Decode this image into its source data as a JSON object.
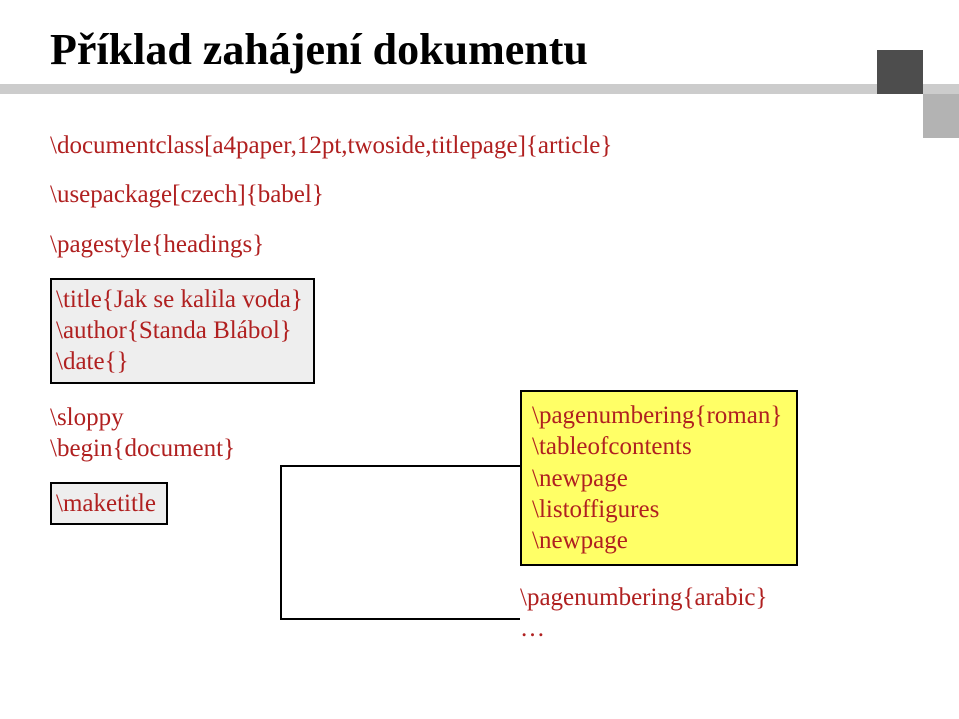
{
  "title": "Příklad zahájení dokumentu",
  "code": {
    "l1": "\\documentclass[a4paper,12pt,twoside,titlepage]{article}",
    "l2": "\\usepackage[czech]{babel}",
    "l3": "\\pagestyle{headings}",
    "l4": "\\title{Jak se kalila voda}",
    "l5": "\\author{Standa Blábol}",
    "l6": "\\date{}",
    "l7": "\\sloppy",
    "l8": "\\begin{document}",
    "l9": "\\maketitle"
  },
  "yellow": {
    "y1": "\\pagenumbering{roman}",
    "y2": "\\tableofcontents",
    "y3": "\\newpage",
    "y4": "\\listoffigures",
    "y5": "\\newpage"
  },
  "trailing": {
    "t1": "\\pagenumbering{arabic}",
    "t2": "…"
  }
}
